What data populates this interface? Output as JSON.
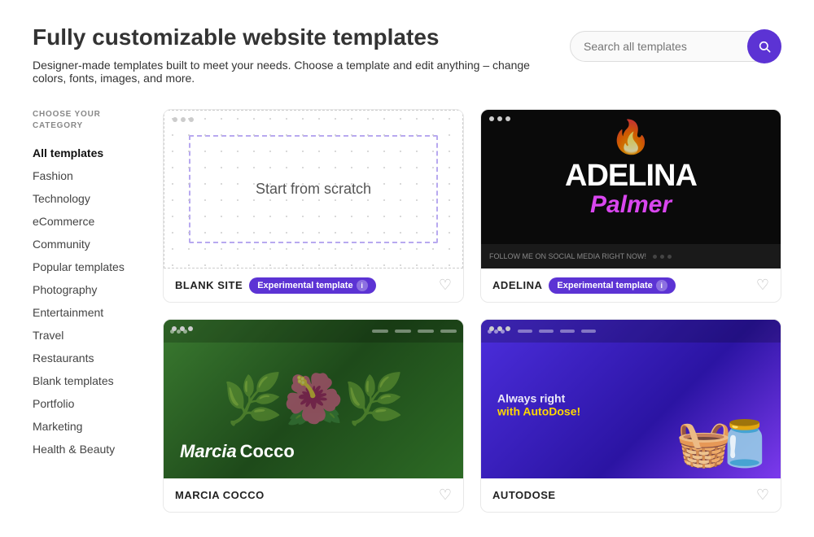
{
  "page": {
    "title": "Fully customizable website templates",
    "subtitle": "Designer-made templates built to meet your needs. Choose a template and edit anything – change colors, fonts, images, and more."
  },
  "search": {
    "placeholder": "Search all templates"
  },
  "sidebar": {
    "category_label": "CHOOSE YOUR CATEGORY",
    "items": [
      {
        "id": "all",
        "label": "All templates",
        "active": true
      },
      {
        "id": "fashion",
        "label": "Fashion",
        "active": false
      },
      {
        "id": "technology",
        "label": "Technology",
        "active": false
      },
      {
        "id": "ecommerce",
        "label": "eCommerce",
        "active": false
      },
      {
        "id": "community",
        "label": "Community",
        "active": false
      },
      {
        "id": "popular",
        "label": "Popular templates",
        "active": false
      },
      {
        "id": "photography",
        "label": "Photography",
        "active": false
      },
      {
        "id": "entertainment",
        "label": "Entertainment",
        "active": false
      },
      {
        "id": "travel",
        "label": "Travel",
        "active": false
      },
      {
        "id": "restaurants",
        "label": "Restaurants",
        "active": false
      },
      {
        "id": "blank",
        "label": "Blank templates",
        "active": false
      },
      {
        "id": "portfolio",
        "label": "Portfolio",
        "active": false
      },
      {
        "id": "marketing",
        "label": "Marketing",
        "active": false
      },
      {
        "id": "health",
        "label": "Health & Beauty",
        "active": false
      }
    ]
  },
  "templates": [
    {
      "id": "blank-site",
      "name": "BLANK SITE",
      "badge": "Experimental template",
      "type": "blank"
    },
    {
      "id": "adelina",
      "name": "ADELINA",
      "badge": "Experimental template",
      "type": "adelina"
    },
    {
      "id": "marcia-cocco",
      "name": "MARCIA COCCO",
      "badge": null,
      "type": "marcia"
    },
    {
      "id": "autodose",
      "name": "AUTODOSE",
      "badge": null,
      "type": "autodose"
    }
  ],
  "icons": {
    "search": "🔍",
    "heart": "♡",
    "info": "i",
    "fire": "🔥",
    "leaf": "🌿",
    "appliance": "🫙"
  }
}
